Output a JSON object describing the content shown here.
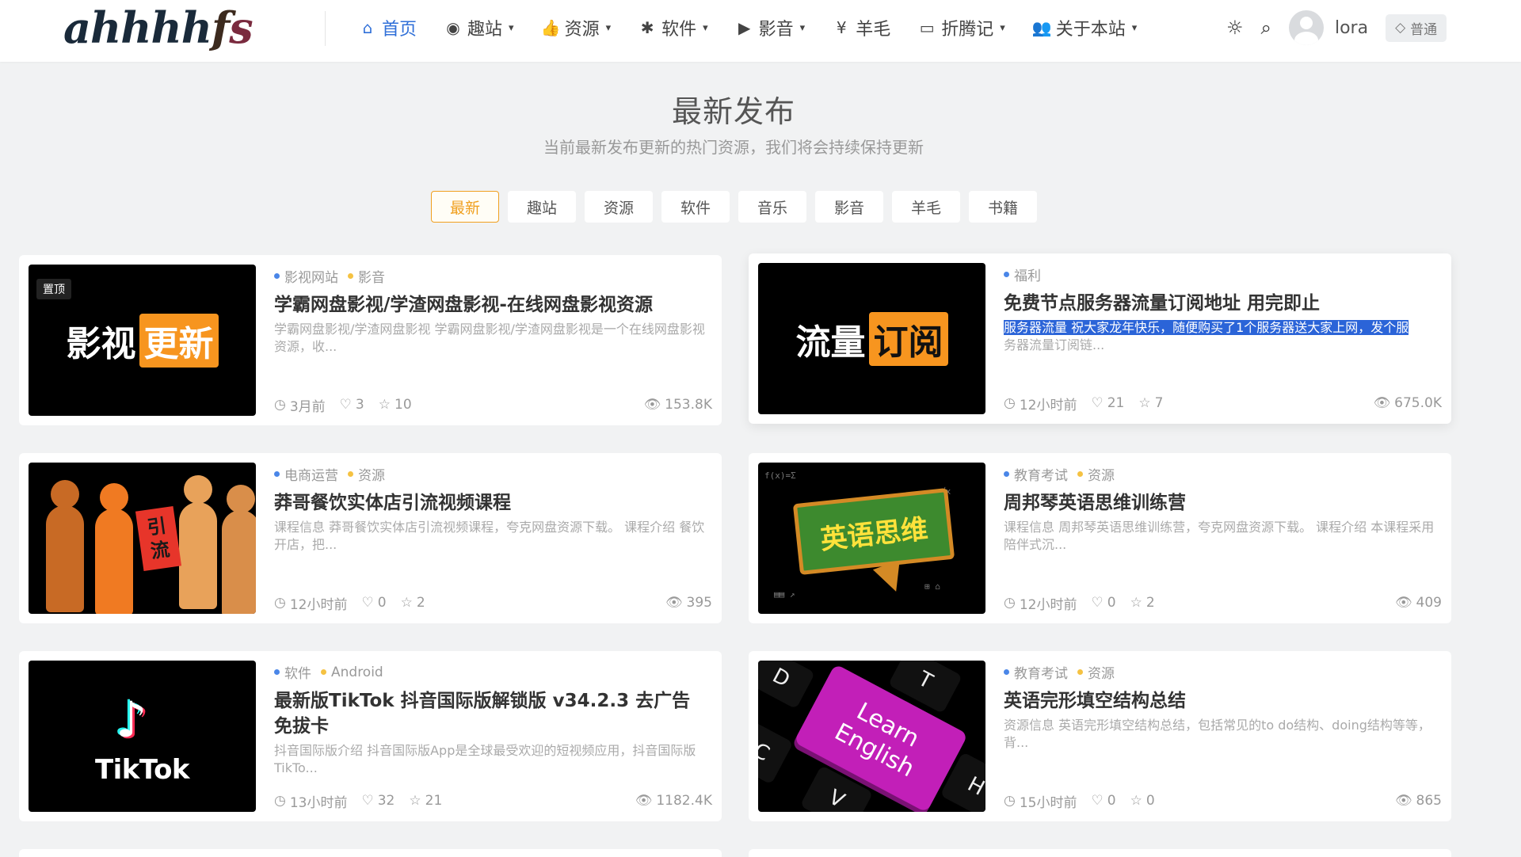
{
  "header": {
    "logo": {
      "a": "ahhhh",
      "f": "f",
      "s": "s"
    },
    "nav": [
      {
        "label": "首页",
        "icon": "home-icon",
        "active": true,
        "dropdown": false
      },
      {
        "label": "趣站",
        "icon": "compass-icon",
        "active": false,
        "dropdown": true
      },
      {
        "label": "资源",
        "icon": "thumbs-up-icon",
        "active": false,
        "dropdown": true
      },
      {
        "label": "软件",
        "icon": "bug-icon",
        "active": false,
        "dropdown": true
      },
      {
        "label": "影音",
        "icon": "video-icon",
        "active": false,
        "dropdown": true
      },
      {
        "label": "羊毛",
        "icon": "yen-icon",
        "active": false,
        "dropdown": false
      },
      {
        "label": "折腾记",
        "icon": "keyboard-icon",
        "active": false,
        "dropdown": true
      },
      {
        "label": "关于本站",
        "icon": "users-icon",
        "active": false,
        "dropdown": true
      }
    ],
    "username": "lora",
    "level": "普通"
  },
  "section": {
    "title": "最新发布",
    "subtitle": "当前最新发布更新的热门资源，我们将会持续保持更新",
    "tabs": [
      "最新",
      "趣站",
      "资源",
      "软件",
      "音乐",
      "影音",
      "羊毛",
      "书籍"
    ],
    "active_tab": "最新"
  },
  "posts": [
    {
      "pinned": "置顶",
      "thumb": {
        "main": "影视",
        "highlight": "更新"
      },
      "tags": [
        {
          "label": "影视网站",
          "color": "blue"
        },
        {
          "label": "影音",
          "color": "yellow"
        }
      ],
      "title": "学霸网盘影视/学渣网盘影视-在线网盘影视资源",
      "excerpt": "学霸网盘影视/学渣网盘影视 学霸网盘影视/学渣网盘影视是一个在线网盘影视资源，收...",
      "time": "3月前",
      "likes": "3",
      "stars": "10",
      "views": "153.8K"
    },
    {
      "thumb": {
        "main": "流量",
        "highlight": "订阅"
      },
      "tags": [
        {
          "label": "福利",
          "color": "blue"
        }
      ],
      "title": "免费节点服务器流量订阅地址 用完即止",
      "excerpt_highlight": "服务器流量 祝大家龙年快乐，随便购买了1个服务器送大家上网，发个服",
      "excerpt_rest": "务器流量订阅链...",
      "time": "12小时前",
      "likes": "21",
      "stars": "7",
      "views": "675.0K"
    },
    {
      "thumb": {
        "label_line1": "引",
        "label_line2": "流"
      },
      "tags": [
        {
          "label": "电商运营",
          "color": "blue"
        },
        {
          "label": "资源",
          "color": "yellow"
        }
      ],
      "title": "莽哥餐饮实体店引流视频课程",
      "excerpt": "课程信息 莽哥餐饮实体店引流视频课程，夸克网盘资源下载。 课程介绍 餐饮开店，把...",
      "time": "12小时前",
      "likes": "0",
      "stars": "2",
      "views": "395"
    },
    {
      "thumb": {
        "board": "英语思维"
      },
      "tags": [
        {
          "label": "教育考试",
          "color": "blue"
        },
        {
          "label": "资源",
          "color": "yellow"
        }
      ],
      "title": "周邦琴英语思维训练营",
      "excerpt": "课程信息 周邦琴英语思维训练营，夸克网盘资源下载。 课程介绍 本课程采用陪伴式沉...",
      "time": "12小时前",
      "likes": "0",
      "stars": "2",
      "views": "409"
    },
    {
      "thumb": {
        "note": "♪",
        "word": "TikTok"
      },
      "tags": [
        {
          "label": "软件",
          "color": "blue"
        },
        {
          "label": "Android",
          "color": "yellow"
        }
      ],
      "title": "最新版TikTok 抖音国际版解锁版 v34.2.3 去广告 免拔卡",
      "excerpt": "抖音国际版介绍 抖音国际版App是全球最受欢迎的短视频应用，抖音国际版TikTo...",
      "time": "13小时前",
      "likes": "32",
      "stars": "21",
      "views": "1182.4K"
    },
    {
      "thumb": {
        "line1": "Learn",
        "line2": "English",
        "keys": [
          "D",
          "T",
          "C",
          "V",
          "H"
        ]
      },
      "tags": [
        {
          "label": "教育考试",
          "color": "blue"
        },
        {
          "label": "资源",
          "color": "yellow"
        }
      ],
      "title": "英语完形填空结构总结",
      "excerpt": "资源信息 英语完形填空结构总结，包括常见的to do结构、doing结构等等，背...",
      "time": "15小时前",
      "likes": "0",
      "stars": "0",
      "views": "865"
    }
  ],
  "colors": {
    "accent": "#2f6fd8",
    "tab_active": "#f0a020",
    "page_bg": "#f1f2f3",
    "card_bg": "#ffffff",
    "tag_dot_blue": "#4a86e8",
    "tag_dot_yellow": "#f5c242",
    "selection": "#2b64d8"
  }
}
